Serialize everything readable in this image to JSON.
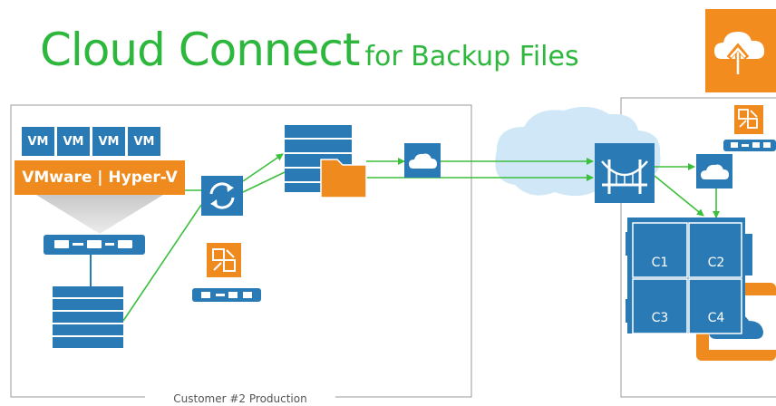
{
  "header": {
    "title_main": "Cloud Connect",
    "title_sub": "for Backup Files"
  },
  "customer_site": {
    "vms": [
      "VM",
      "VM",
      "VM",
      "VM"
    ],
    "hypervisor_label": "VMware | Hyper-V",
    "caption": "Customer #2 Production"
  },
  "provider_site": {
    "cells": [
      "C1",
      "C2",
      "C3",
      "C4"
    ]
  },
  "icons": {
    "logo": "cloud-upload-icon",
    "replication": "sync-arrows-icon",
    "tenant": "backup-replication-icon",
    "gateway": "bridge-icon",
    "cloud": "cloud-icon"
  },
  "colors": {
    "brand_green": "#2db83d",
    "blue": "#2a7ab6",
    "orange": "#ef8b1e",
    "link": "#3cbf3c",
    "sky": "#cfe7f6"
  }
}
